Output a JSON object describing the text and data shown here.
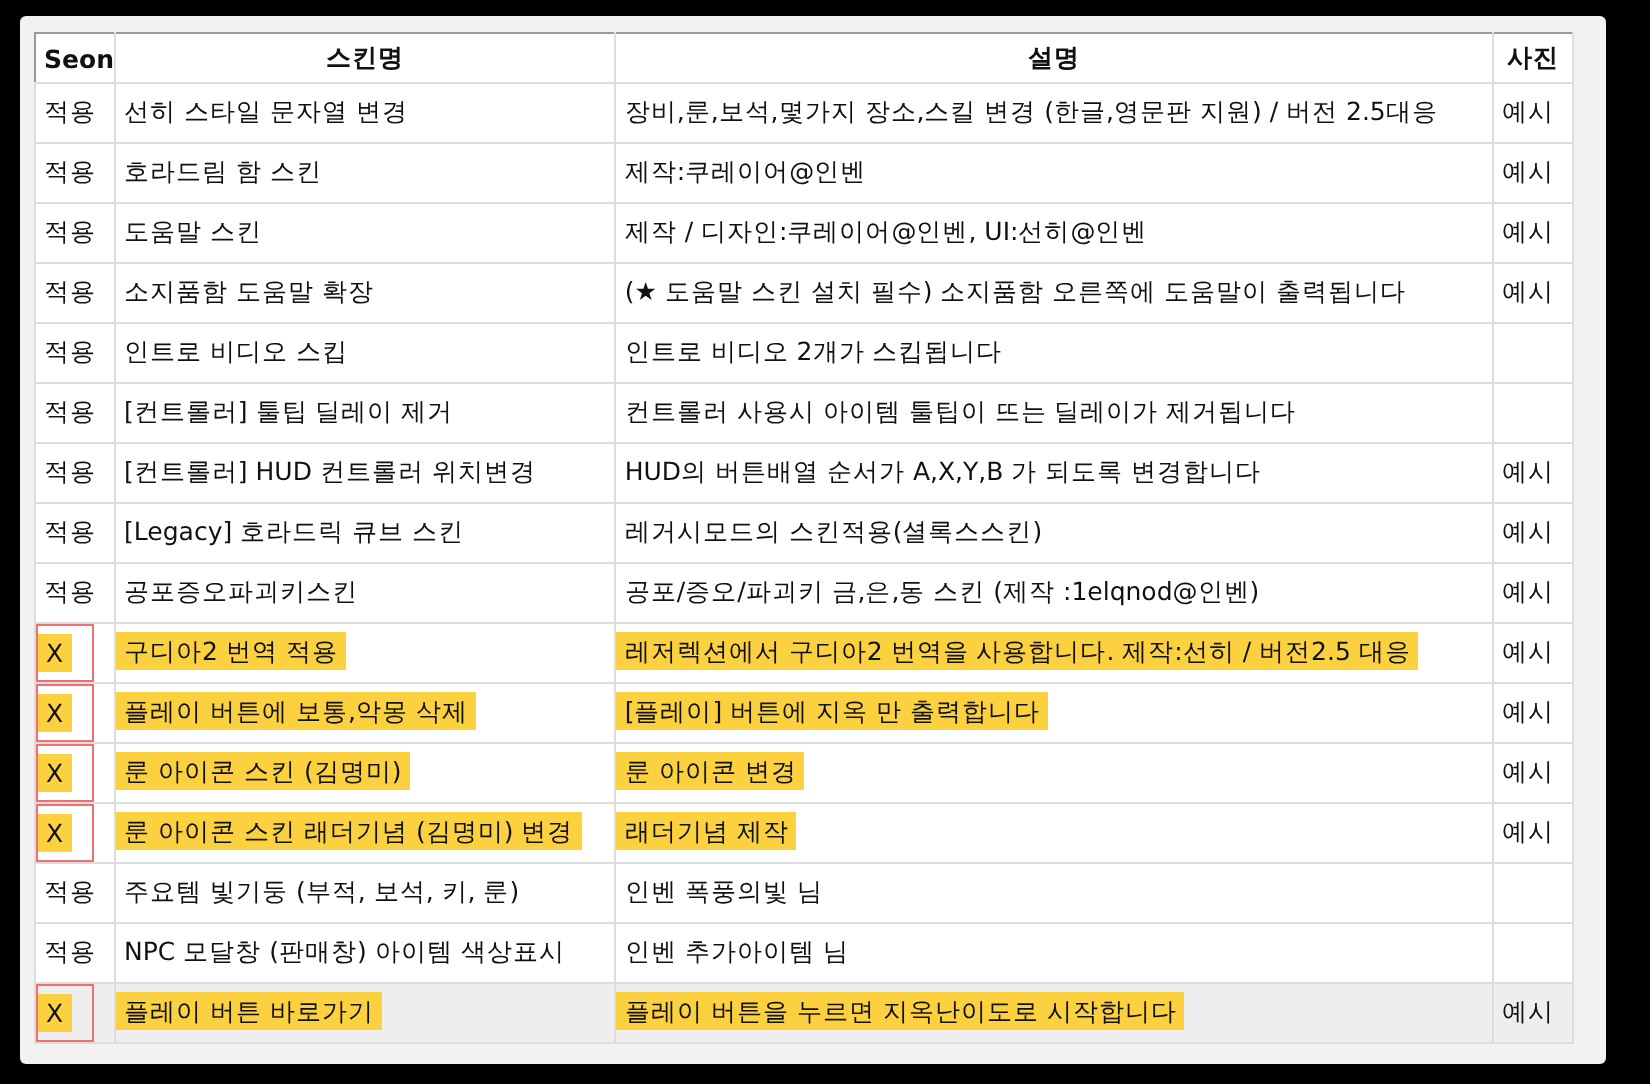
{
  "table": {
    "columns": [
      "Seon",
      "스킨명",
      "설명",
      "사진"
    ],
    "rows": [
      {
        "status": "적용",
        "name": "선히 스타일 문자열 변경",
        "description": "장비,룬,보석,몇가지 장소,스킬 변경 (한글,영문판 지원) / 버전 2.5대응",
        "photo": "예시",
        "highlighted": false,
        "marked": false,
        "selected": false
      },
      {
        "status": "적용",
        "name": "호라드림 함 스킨",
        "description": "제작:쿠레이어@인벤",
        "photo": "예시",
        "highlighted": false,
        "marked": false,
        "selected": false
      },
      {
        "status": "적용",
        "name": "도움말 스킨",
        "description": "제작 / 디자인:쿠레이어@인벤, UI:선히@인벤",
        "photo": "예시",
        "highlighted": false,
        "marked": false,
        "selected": false
      },
      {
        "status": "적용",
        "name": "소지품함 도움말 확장",
        "description": "(★ 도움말 스킨 설치 필수) 소지품함 오른쪽에 도움말이 출력됩니다",
        "photo": "예시",
        "highlighted": false,
        "marked": false,
        "selected": false
      },
      {
        "status": "적용",
        "name": "인트로 비디오 스킵",
        "description": "인트로 비디오 2개가 스킵됩니다",
        "highlighted": false,
        "marked": false,
        "selected": false
      },
      {
        "status": "적용",
        "name": "[컨트롤러] 툴팁 딜레이 제거",
        "description": "컨트롤러 사용시 아이템 툴팁이 뜨는 딜레이가 제거됩니다",
        "highlighted": false,
        "marked": false,
        "selected": false
      },
      {
        "status": "적용",
        "name": "[컨트롤러] HUD 컨트롤러 위치변경",
        "description": "HUD의 버튼배열 순서가 A,X,Y,B 가 되도록 변경합니다",
        "photo": "예시",
        "highlighted": false,
        "marked": false,
        "selected": false
      },
      {
        "status": "적용",
        "name": "[Legacy] 호라드릭 큐브 스킨",
        "description": "레거시모드의 스킨적용(셜록스스킨)",
        "photo": "예시",
        "highlighted": false,
        "marked": false,
        "selected": false
      },
      {
        "status": "적용",
        "name": "공포증오파괴키스킨",
        "description": "공포/증오/파괴키 금,은,동 스킨 (제작 :1elqnod@인벤)",
        "photo": "예시",
        "highlighted": false,
        "marked": false,
        "selected": false
      },
      {
        "status": "X",
        "name": "구디아2 번역 적용",
        "description": "레저렉션에서 구디아2 번역을 사용합니다. 제작:선히 / 버전2.5 대응",
        "photo": "예시",
        "highlighted": true,
        "marked": true,
        "selected": false
      },
      {
        "status": "X",
        "name": "플레이 버튼에 보통,악몽 삭제",
        "description": "[플레이] 버튼에 지옥 만 출력합니다",
        "photo": "예시",
        "highlighted": true,
        "marked": true,
        "selected": false
      },
      {
        "status": "X",
        "name": "룬 아이콘 스킨 (김명미)",
        "description": "룬 아이콘 변경",
        "photo": "예시",
        "highlighted": true,
        "marked": true,
        "selected": false
      },
      {
        "status": "X",
        "name": "룬 아이콘 스킨 래더기념 (김명미) 변경",
        "description": "래더기념 제작",
        "photo": "예시",
        "highlighted": true,
        "marked": true,
        "selected": false
      },
      {
        "status": "적용",
        "name": "주요템 빛기둥 (부적, 보석, 키, 룬)",
        "description": "인벤 폭풍의빛 님",
        "highlighted": false,
        "marked": false,
        "selected": false
      },
      {
        "status": "적용",
        "name": "NPC 모달창 (판매창) 아이템 색상표시",
        "description": "인벤 추가아이템 님",
        "highlighted": false,
        "marked": false,
        "selected": false
      },
      {
        "status": "X",
        "name": "플레이 버튼 바로가기",
        "description": "플레이 버튼을 누르면 지옥난이도로 시작합니다",
        "photo": "예시",
        "highlighted": true,
        "marked": true,
        "selected": true
      }
    ]
  }
}
